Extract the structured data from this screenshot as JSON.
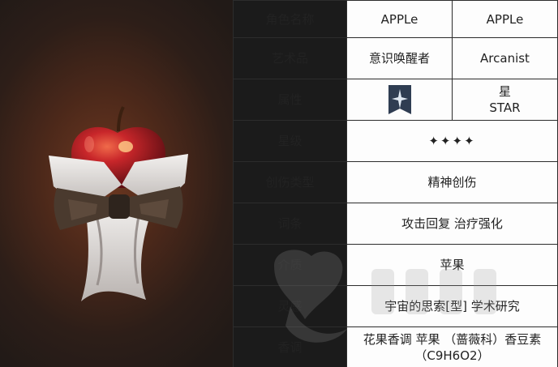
{
  "rows": {
    "name": {
      "label": "角色名称",
      "value1": "APPLe",
      "value2": "APPLe"
    },
    "art": {
      "label": "艺术品",
      "value1": "意识唤醒者",
      "value2": "Arcanist"
    },
    "attribute": {
      "label": "属性",
      "icon": "star-attribute-icon",
      "value_line1": "星",
      "value_line2": "STAR"
    },
    "rarity": {
      "label": "星级",
      "value": "✦✦✦✦"
    },
    "damage_type": {
      "label": "创伤类型",
      "value": "精神创伤"
    },
    "tags": {
      "label": "词条",
      "value": "攻击回复 治疗强化"
    },
    "medium": {
      "label": "介质",
      "value": "苹果"
    },
    "inspiration": {
      "label": "灵感",
      "value": "宇宙的思索[型] 学术研究"
    },
    "fragrance": {
      "label": "香调",
      "value_line1": "花果香调 苹果 （蔷薇科）香豆素",
      "value_line2": "（C9H6O2）"
    }
  },
  "portrait": {
    "subject": "apple-with-bowtie-illustration",
    "background_color": "#4b281a"
  },
  "colors": {
    "label_bg": "#1b1b1b",
    "label_text": "#ffffff",
    "value_bg": "#fdfdfd",
    "border": "#2c2c2c"
  }
}
